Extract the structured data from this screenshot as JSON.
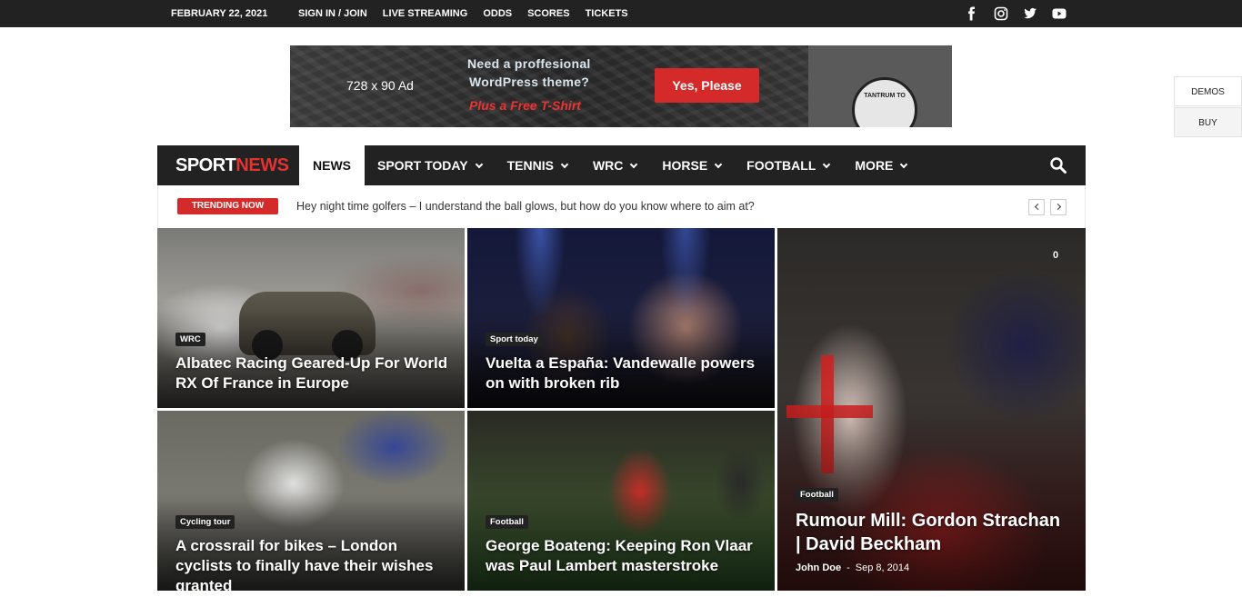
{
  "topbar": {
    "date": "FEBRUARY 22, 2021",
    "links": [
      "SIGN IN / JOIN",
      "LIVE STREAMING",
      "ODDS",
      "SCORES",
      "TICKETS"
    ],
    "social_icons": [
      "facebook-icon",
      "instagram-icon",
      "twitter-icon",
      "youtube-icon"
    ]
  },
  "ad": {
    "size_label": "728 x 90 Ad",
    "line1": "Need a proffesional",
    "line2": "WordPress theme?",
    "line3": "Plus a Free T-Shirt",
    "button": "Yes, Please",
    "shirt_text": "TANTRUM TO"
  },
  "side": {
    "demos": "DEMOS",
    "buy": "BUY"
  },
  "nav": {
    "logo_part1": "SPORT",
    "logo_part2": "NEWS",
    "items": [
      {
        "label": "NEWS",
        "active": true,
        "dropdown": false
      },
      {
        "label": "SPORT TODAY",
        "active": false,
        "dropdown": true
      },
      {
        "label": "TENNIS",
        "active": false,
        "dropdown": true
      },
      {
        "label": "WRC",
        "active": false,
        "dropdown": true
      },
      {
        "label": "HORSE",
        "active": false,
        "dropdown": true
      },
      {
        "label": "FOOTBALL",
        "active": false,
        "dropdown": true
      },
      {
        "label": "MORE",
        "active": false,
        "dropdown": true
      }
    ]
  },
  "trending": {
    "label": "TRENDING NOW",
    "headline": "Hey night time golfers – I understand the ball glows, but how do you know where to aim at?"
  },
  "articles": [
    {
      "category": "WRC",
      "title": "Albatec Racing Geared-Up For World RX Of France in Europe"
    },
    {
      "category": "Sport today",
      "title": "Vuelta a España: Vandewalle powers on with broken rib"
    },
    {
      "category": "Football",
      "title": "Rumour Mill: Gordon Strachan | David Beckham",
      "comments": "0",
      "author": "John Doe",
      "date": "Sep 8, 2014"
    },
    {
      "category": "Cycling tour",
      "title": "A crossrail for bikes – London cyclists to finally have their wishes granted"
    },
    {
      "category": "Football",
      "title": "George Boateng: Keeping Ron Vlaar was Paul Lambert masterstroke"
    }
  ],
  "colors": {
    "accent": "#d42a2a",
    "dark": "#222222"
  }
}
